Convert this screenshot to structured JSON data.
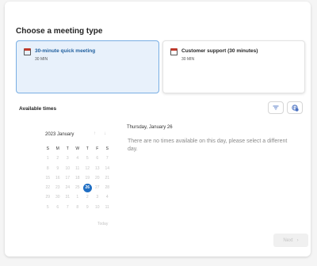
{
  "title": "Choose a meeting type",
  "meeting_types": [
    {
      "name": "30-minute quick meeting",
      "duration": "30 MIN",
      "selected": true
    },
    {
      "name": "Customer support (30 minutes)",
      "duration": "30 MIN",
      "selected": false
    }
  ],
  "available_times_label": "Available times",
  "icons": {
    "filter": "filter-icon",
    "timezone": "globe-clock-icon",
    "card": "calendar-icon"
  },
  "calendar": {
    "month_label": "2023 January",
    "weekday_headers": [
      "S",
      "M",
      "T",
      "W",
      "T",
      "F",
      "S"
    ],
    "weeks": [
      [
        "1",
        "2",
        "3",
        "4",
        "5",
        "6",
        "7"
      ],
      [
        "8",
        "9",
        "10",
        "11",
        "12",
        "13",
        "14"
      ],
      [
        "15",
        "16",
        "17",
        "18",
        "19",
        "20",
        "21"
      ],
      [
        "22",
        "23",
        "24",
        "25",
        "26",
        "27",
        "28"
      ],
      [
        "29",
        "30",
        "31",
        "1",
        "2",
        "3",
        "4"
      ],
      [
        "5",
        "6",
        "7",
        "8",
        "9",
        "10",
        "11"
      ]
    ],
    "selected_day": "26",
    "today_label": "Today"
  },
  "selected_date_heading": "Thursday, January 26",
  "no_times_message": "There are no times available on this day, please select a different day.",
  "next_label": "Next",
  "colors": {
    "accent": "#1f6ec3",
    "selected_card_bg": "#e8f1fb",
    "selected_card_border": "#79aee3"
  }
}
